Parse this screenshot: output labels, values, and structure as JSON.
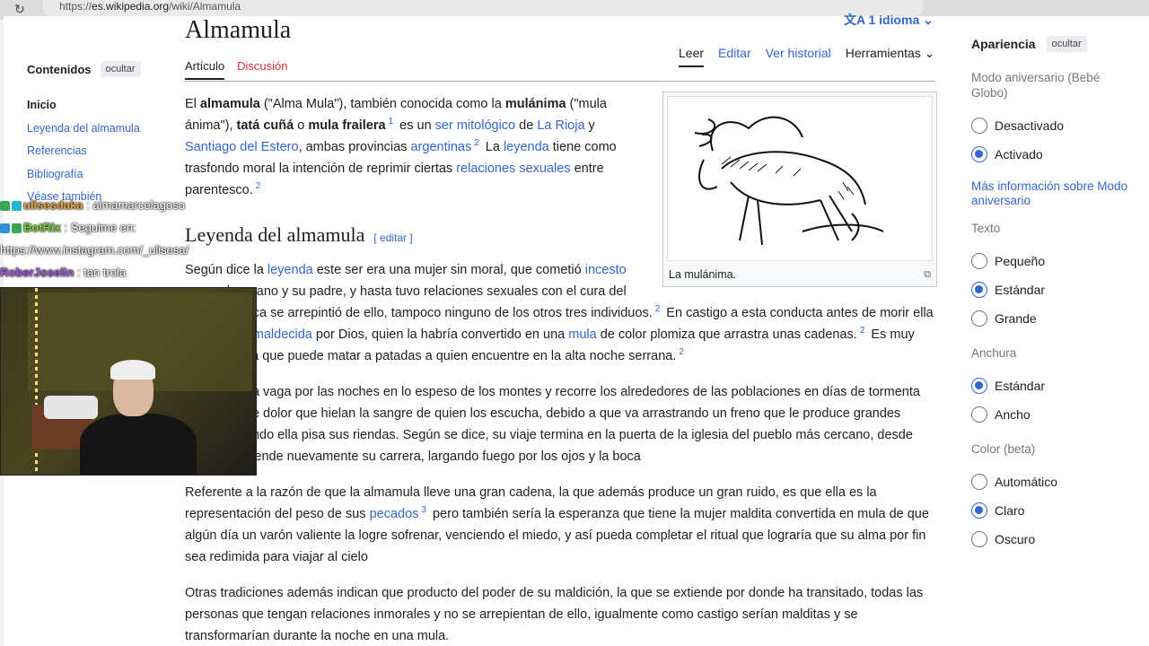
{
  "browser": {
    "url_prefix": "https://",
    "url_host": "es.wikipedia.org",
    "url_path": "/wiki/Almamula"
  },
  "header": {
    "title": "Almamula",
    "language": "1 idioma"
  },
  "tabs": {
    "left": [
      "Artículo",
      "Discusión"
    ],
    "right": [
      "Leer",
      "Editar",
      "Ver historial",
      "Herramientas"
    ]
  },
  "toc": {
    "title": "Contenidos",
    "hide_label": "ocultar",
    "items": [
      "Inicio",
      "Leyenda del almamula",
      "Referencias",
      "Bibliografía",
      "Véase también"
    ]
  },
  "article": {
    "p1": {
      "t1": "El ",
      "b1": "almamula",
      "t2": " (\"Alma Mula\"), también conocida como la ",
      "b2": "mulánima",
      "t3": " (\"mula ánima\"), ",
      "b3": "tatá cuñá",
      "t4": " o ",
      "b4": "mula frailera",
      "sup1": "1",
      "t5": " es un ",
      "l1": "ser mitológico",
      "t6": " de ",
      "l2": "La Rioja",
      "t7": " y ",
      "l3": "Santiago del Estero",
      "t8": ", ambas provincias ",
      "l4": "argentinas",
      "sup2": "2",
      "t9": " La ",
      "l5": "leyenda",
      "t10": " tiene como trasfondo moral la intención de reprimir ciertas ",
      "l6": "relaciones sexuales",
      "t11": " entre parentesco.",
      "sup3": "2"
    },
    "infobox_caption": "La mulánima.",
    "section_title": "Leyenda del almamula",
    "section_edit": "[ editar ]",
    "p2": {
      "t1": "Según dice la ",
      "l1": "leyenda",
      "t2": " este ser era una mujer sin moral, que cometió ",
      "l2": "incesto",
      "t3": " con su hermano y su padre, y hasta tuvo relaciones sexuales con el cura del pueblo, nunca se arrepintió de ello, tampoco ninguno de los otros tres individuos.",
      "sup1": "2",
      "t4": " En castigo a esta conducta antes de morir ella habría sido ",
      "l3": "maldecida",
      "t5": " por Dios, quien la habría convertido en una ",
      "l4": "mula",
      "t6": " de color plomiza que arrastra unas cadenas.",
      "sup2": "2",
      "t7": " Es muy peligrosa, ya que puede matar a patadas a quien encuentre en la alta noche serrana.",
      "sup3": "2"
    },
    "p3": "La almamula vaga por las noches en lo espeso de los montes y recorre los alrededores de las poblaciones en días de tormenta con gritos de dolor que hielan la sangre de quien los escucha, debido a que va arrastrando un freno que le produce grandes dolores cuando ella pisa sus riendas. Según se dice, su viaje termina en la puerta de la iglesia del pueblo más cercano, desde donde emprende nuevamente su carrera, largando fuego por los ojos y la boca",
    "p4": {
      "t1": "Referente a la razón de que la almamula lleve una gran cadena, la que además produce un gran ruido, es que ella es la representación del peso de sus ",
      "l1": "pecados",
      "sup1": "3",
      "t2": " pero también sería la esperanza que tiene la mujer maldita convertida en mula de que algún día un varón valiente la logre sofrenar, venciendo el miedo, y así pueda completar el ritual que lograría que su alma por fin sea redimida para viajar al cielo"
    },
    "p5": "Otras tradiciones además indican que producto del poder de su maldición, la que se extiende por donde ha transitado, todas las personas que tengan relaciones inmorales y no se arrepientan de ello, igualmente como castigo serían malditas y se transformarían durante la noche en una mula."
  },
  "appearance": {
    "title": "Apariencia",
    "hide_label": "ocultar",
    "anniversary_label": "Modo aniversario (Bebé Globo)",
    "anniversary_options": [
      "Desactivado",
      "Activado"
    ],
    "anniversary_selected": "Activado",
    "more_info": "Más información sobre Modo aniversario",
    "text_label": "Texto",
    "text_options": [
      "Pequeño",
      "Estándar",
      "Grande"
    ],
    "width_label": "Anchura",
    "width_options": [
      "Estándar",
      "Ancho"
    ],
    "color_label": "Color (beta)",
    "color_options": [
      "Automático",
      "Claro",
      "Oscuro"
    ]
  },
  "chat": [
    {
      "user": "ulisesdaka",
      "sep": " : ",
      "msg": "almamarcelagoso",
      "color": "#e3a23a"
    },
    {
      "user": "BotRix",
      "sep": " : ",
      "msg": "Seguime en:",
      "color": "#7ad13a"
    },
    {
      "user": "",
      "sep": "",
      "msg": "https://www.instagram.com/_ulisesa/",
      "color": "#ffffff"
    },
    {
      "user": "RoberJoselin",
      "sep": " : ",
      "msg": "tan trola",
      "color": "#9b5bd6"
    }
  ],
  "colors": {
    "link": "#3366cc",
    "accent_red": "#d73333",
    "radio_on": "#3366cc"
  }
}
